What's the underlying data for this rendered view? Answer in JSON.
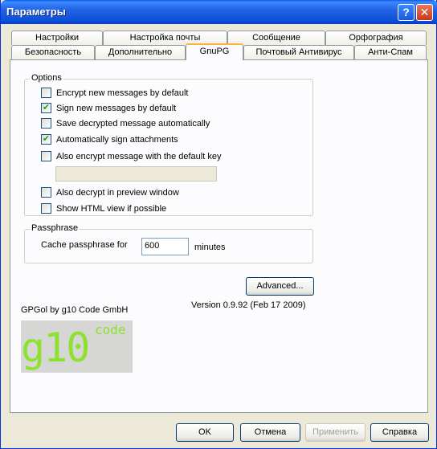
{
  "window": {
    "title": "Параметры",
    "help_glyph": "?",
    "close_glyph": "✕"
  },
  "tabs_row1": [
    "Настройки",
    "Настройка почты",
    "Сообщение",
    "Орфография"
  ],
  "tabs_row2": [
    "Безопасность",
    "Дополнительно",
    "GnuPG",
    "Почтовый Антивирус",
    "Анти-Спам"
  ],
  "active_tab": "GnuPG",
  "options": {
    "label": "Options",
    "items": [
      {
        "label": "Encrypt new messages by default",
        "checked": false
      },
      {
        "label": "Sign new messages by default",
        "checked": true
      },
      {
        "label": "Save decrypted message automatically",
        "checked": false
      },
      {
        "label": "Automatically sign attachments",
        "checked": true
      },
      {
        "label": "Also encrypt message with the default key",
        "checked": false
      },
      {
        "label": "Also decrypt in preview window",
        "checked": false
      },
      {
        "label": "Show HTML view if possible",
        "checked": false
      }
    ],
    "default_key_value": ""
  },
  "passphrase": {
    "label": "Passphrase",
    "cache_label": "Cache passphrase for",
    "value": "600",
    "unit": "minutes"
  },
  "advanced_label": "Advanced...",
  "about": "GPGol by g10 Code GmbH",
  "version": "Version 0.9.92 (Feb 17 2009)",
  "logo": {
    "main": "g10",
    "sup": "code"
  },
  "buttons": {
    "ok": "OK",
    "cancel": "Отмена",
    "apply": "Применить",
    "help": "Справка"
  },
  "colors": {
    "titlebar": "#0a4fd8",
    "logo_green": "#8ee12e",
    "active_tab_accent": "#f7b535"
  }
}
